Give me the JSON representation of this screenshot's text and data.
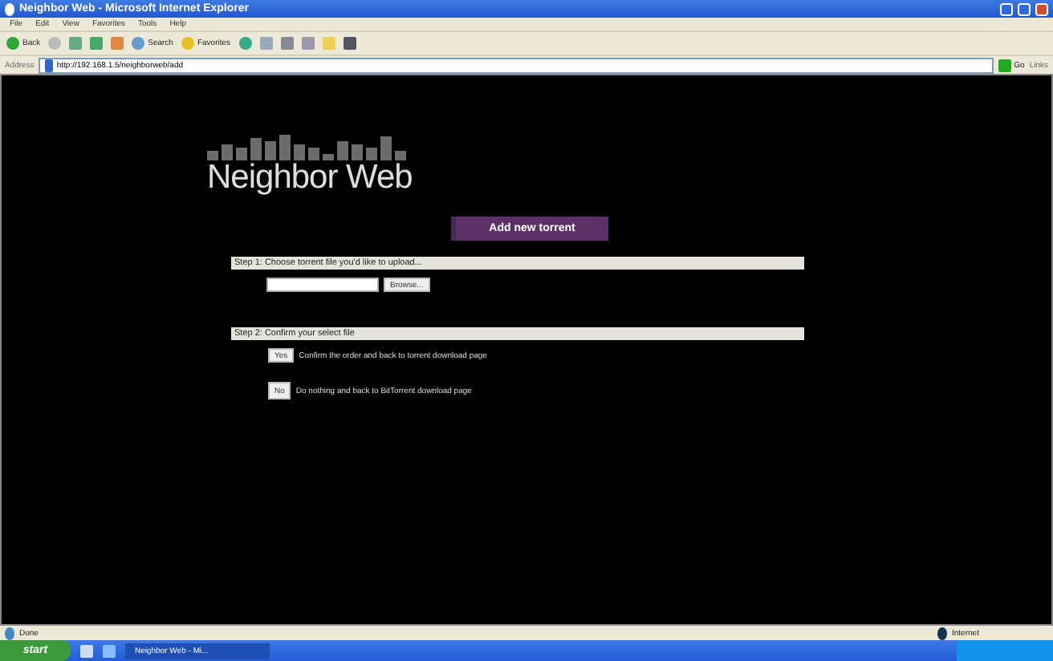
{
  "window": {
    "title": "Neighbor Web - Microsoft Internet Explorer"
  },
  "menu": [
    "File",
    "Edit",
    "View",
    "Favorites",
    "Tools",
    "Help"
  ],
  "toolbar": {
    "back": "Back",
    "search": "Search",
    "favorites": "Favorites"
  },
  "address_bar": {
    "label": "Address",
    "value": "http://192.168.1.5/neighborweb/add",
    "go": "Go",
    "links": "Links"
  },
  "page": {
    "logo": "Neighbor Web",
    "add_button": "Add new torrent",
    "step1": {
      "heading": "Step 1: Choose torrent file you'd like to upload...",
      "browse": "Browse..."
    },
    "step2": {
      "heading": "Step 2: Confirm your select file",
      "options": [
        {
          "button": "Yes",
          "text": "Confirm the order and back to torrent download page"
        },
        {
          "button": "No",
          "text": "Do nothing and back to BitTorrent download page"
        }
      ]
    }
  },
  "status_bar": {
    "status": "Done",
    "zone": "Internet"
  },
  "taskbar": {
    "start": "start",
    "tasks": [
      {
        "label": "Neighbor Web - Mi...",
        "selected": true
      }
    ]
  }
}
